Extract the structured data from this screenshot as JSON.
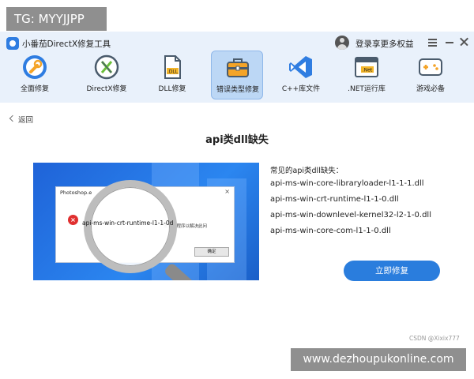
{
  "overlay": {
    "tg_badge": "TG: MYYJJPP",
    "site_banner": "www.dezhoupukonline.com",
    "csdn_credit": "CSDN @Xixix777"
  },
  "app": {
    "title": "小番茄DirectX修复工具",
    "login_label": "登录享更多权益"
  },
  "nav": {
    "items": [
      {
        "label": "全面修复",
        "icon": "wrench-icon"
      },
      {
        "label": "DirectX修复",
        "icon": "directx-icon"
      },
      {
        "label": "DLL修复",
        "icon": "dll-file-icon"
      },
      {
        "label": "错误类型修复",
        "icon": "toolbox-icon",
        "active": true
      },
      {
        "label": "C++库文件",
        "icon": "visual-studio-icon"
      },
      {
        "label": ".NET运行库",
        "icon": "dotnet-icon"
      },
      {
        "label": "游戏必备",
        "icon": "gamepad-icon"
      }
    ]
  },
  "page": {
    "back_label": "返回",
    "title": "api类dll缺失",
    "missing_heading": "常见的api类dll缺失：",
    "dll_list": [
      "api-ms-win-core-libraryloader-l1-1-1.dll",
      "api-ms-win-crt-runtime-l1-1-0.dll",
      "api-ms-win-downlevel-kernel32-l2-1-0.dll",
      "api-ms-win-core-com-l1-1-0.dll"
    ],
    "repair_button": "立即修复"
  },
  "screenshot": {
    "dialog_title": "Photoshop.e",
    "dialog_close": "×",
    "dialog_message": "安装该程序以解决此问",
    "magnified_text": "api-ms-win-crt-runtime-l1-1-0d",
    "ok_button": "确定",
    "error_symbol": "×"
  },
  "colors": {
    "accent": "#2a7ddd",
    "header_bg": "#e9f1fb",
    "active_nav_bg": "#bcd7f5",
    "overlay_gray": "#8f8f8f"
  }
}
